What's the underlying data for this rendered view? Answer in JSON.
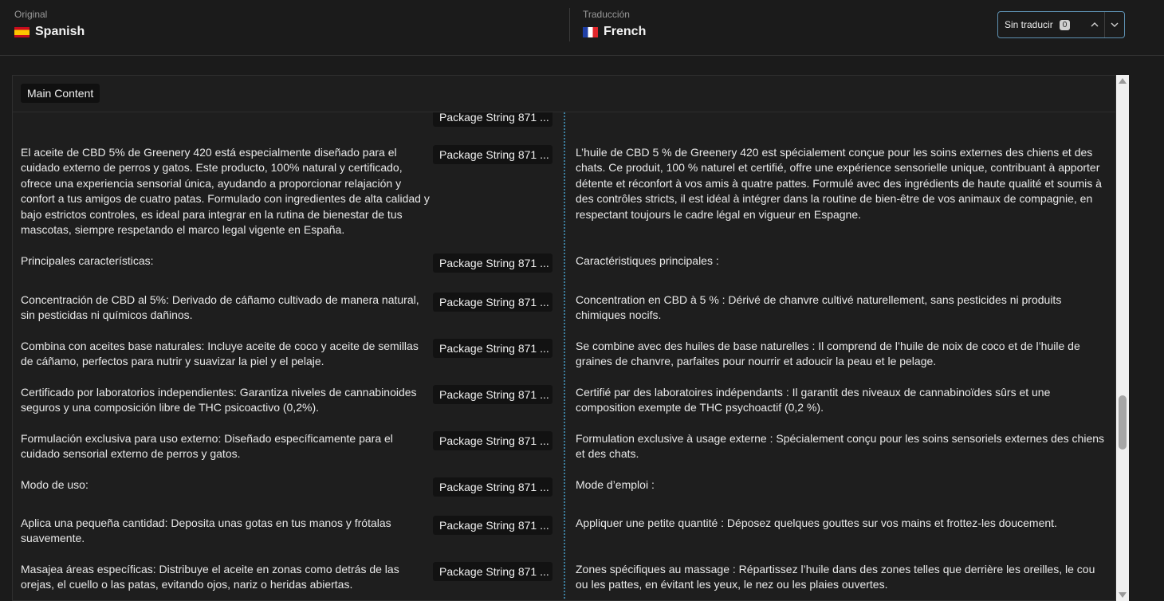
{
  "header": {
    "original_caption": "Original",
    "original_language": "Spanish",
    "translation_caption": "Traducción",
    "translation_language": "French",
    "untranslated_label": "Sin traducir",
    "untranslated_count": "0"
  },
  "section": {
    "title": "Main Content"
  },
  "rows": [
    {
      "source": "El aceite de CBD 5% de Greenery 420 está especialmente diseñado para el cuidado externo de perros y gatos. Este producto, 100% natural y certificado, ofrece una experiencia sensorial única, ayudando a proporcionar relajación y confort a tus amigos de cuatro patas. Formulado con ingredientes de alta calidad y bajo estrictos controles, es ideal para integrar en la rutina de bienestar de tus mascotas, siempre respetando el marco legal vigente en España.",
      "key": "Package String 871 ...",
      "target": "L’huile de CBD 5 % de Greenery 420 est spécialement conçue pour les soins externes des chiens et des chats. Ce produit, 100 % naturel et certifié, offre une expérience sensorielle unique, contribuant à apporter détente et réconfort à vos amis à quatre pattes. Formulé avec des ingrédients de haute qualité et soumis à des contrôles stricts, il est idéal à intégrer dans la routine de bien-être de vos animaux de compagnie, en respectant toujours le cadre légal en vigueur en Espagne."
    },
    {
      "source": "Principales características:",
      "key": "Package String 871 ...",
      "target": "Caractéristiques principales :"
    },
    {
      "source": "Concentración de CBD al 5%: Derivado de cáñamo cultivado de manera natural, sin pesticidas ni químicos dañinos.",
      "key": "Package String 871 ...",
      "target": "Concentration en CBD à 5 % : Dérivé de chanvre cultivé naturellement, sans pesticides ni produits chimiques nocifs."
    },
    {
      "source": "Combina con aceites base naturales: Incluye aceite de coco y aceite de semillas de cáñamo, perfectos para nutrir y suavizar la piel y el pelaje.",
      "key": "Package String 871 ...",
      "target": "Se combine avec des huiles de base naturelles : Il comprend de l’huile de noix de coco et de l’huile de graines de chanvre, parfaites pour nourrir et adoucir la peau et le pelage."
    },
    {
      "source": "Certificado por laboratorios independientes: Garantiza niveles de cannabinoides seguros y una composición libre de THC psicoactivo (0,2%).",
      "key": "Package String 871 ...",
      "target": "Certifié par des laboratoires indépendants : Il garantit des niveaux de cannabinoïdes sûrs et une composition exempte de THC psychoactif (0,2 %)."
    },
    {
      "source": "Formulación exclusiva para uso externo: Diseñado específicamente para el cuidado sensorial externo de perros y gatos.",
      "key": "Package String 871 ...",
      "target": "Formulation exclusive à usage externe : Spécialement conçu pour les soins sensoriels externes des chiens et des chats."
    },
    {
      "source": "Modo de uso:",
      "key": "Package String 871 ...",
      "target": "Mode d’emploi :"
    },
    {
      "source": "Aplica una pequeña cantidad: Deposita unas gotas en tus manos y frótalas suavemente.",
      "key": "Package String 871 ...",
      "target": "Appliquer une petite quantité : Déposez quelques gouttes sur vos mains et frottez-les doucement."
    },
    {
      "source": "Masajea áreas específicas: Distribuye el aceite en zonas como detrás de las orejas, el cuello o las patas, evitando ojos, nariz o heridas abiertas.",
      "key": "Package String 871 ...",
      "target": "Zones spécifiques au massage : Répartissez l’huile dans des zones telles que derrière les oreilles, le cou ou les pattes, en évitant les yeux, le nez ou les plaies ouvertes."
    }
  ]
}
